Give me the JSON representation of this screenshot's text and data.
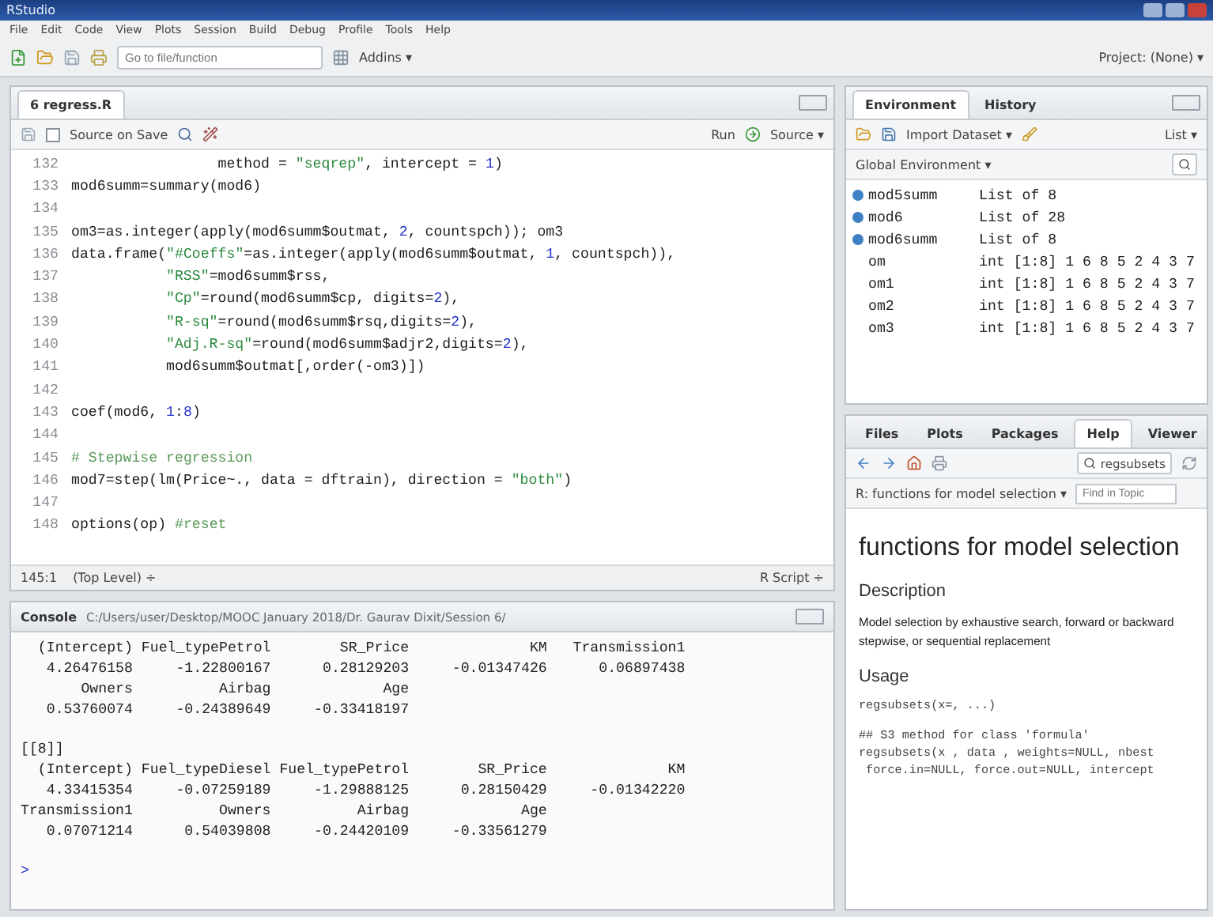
{
  "window": {
    "title": "RStudio"
  },
  "menu": [
    "File",
    "Edit",
    "Code",
    "View",
    "Plots",
    "Session",
    "Build",
    "Debug",
    "Profile",
    "Tools",
    "Help"
  ],
  "toolbar": {
    "goto_placeholder": "Go to file/function",
    "addins": "Addins ▾",
    "project": "Project: (None) ▾"
  },
  "editor": {
    "tabs": [
      {
        "label": "6 regress.R",
        "selected": true
      }
    ],
    "toolbar": {
      "source_on_save": "Source on Save",
      "source_on_save_checked": false,
      "run": "Run",
      "source": "Source ▾"
    },
    "lines": [
      {
        "number": "132",
        "segments": [
          {
            "kind": "plain",
            "text": "                 method = "
          },
          {
            "kind": "string",
            "text": "\"seqrep\""
          },
          {
            "kind": "plain",
            "text": ", intercept = "
          },
          {
            "kind": "number",
            "text": "1"
          },
          {
            "kind": "plain",
            "text": ")"
          }
        ]
      },
      {
        "number": "133",
        "segments": [
          {
            "kind": "plain",
            "text": "mod6summ=summary(mod6)"
          }
        ]
      },
      {
        "number": "134"
      },
      {
        "number": "135",
        "segments": [
          {
            "kind": "plain",
            "text": "om3=as.integer(apply(mod6summ$outmat, "
          },
          {
            "kind": "number",
            "text": "2"
          },
          {
            "kind": "plain",
            "text": ", countspch)); om3"
          }
        ]
      },
      {
        "number": "136",
        "segments": [
          {
            "kind": "plain",
            "text": "data.frame("
          },
          {
            "kind": "string",
            "text": "\"#Coeffs\""
          },
          {
            "kind": "plain",
            "text": "=as.integer(apply(mod6summ$outmat, "
          },
          {
            "kind": "number",
            "text": "1"
          },
          {
            "kind": "plain",
            "text": ", countspch)),"
          }
        ]
      },
      {
        "number": "137",
        "indented": true,
        "segments": [
          {
            "kind": "string",
            "text": "\"RSS\""
          },
          {
            "kind": "plain",
            "text": "=mod6summ$rss,"
          }
        ]
      },
      {
        "number": "138",
        "indented": true,
        "segments": [
          {
            "kind": "string",
            "text": "\"Cp\""
          },
          {
            "kind": "plain",
            "text": "=round(mod6summ$cp, digits="
          },
          {
            "kind": "number",
            "text": "2"
          },
          {
            "kind": "plain",
            "text": "),"
          }
        ]
      },
      {
        "number": "139",
        "indented": true,
        "segments": [
          {
            "kind": "string",
            "text": "\"R-sq\""
          },
          {
            "kind": "plain",
            "text": "=round(mod6summ$rsq,digits="
          },
          {
            "kind": "number",
            "text": "2"
          },
          {
            "kind": "plain",
            "text": "),"
          }
        ]
      },
      {
        "number": "140",
        "indented": true,
        "segments": [
          {
            "kind": "string",
            "text": "\"Adj.R-sq\""
          },
          {
            "kind": "plain",
            "text": "=round(mod6summ$adjr2,digits="
          },
          {
            "kind": "number",
            "text": "2"
          },
          {
            "kind": "plain",
            "text": "),"
          }
        ]
      },
      {
        "number": "141",
        "indented": true,
        "segments": [
          {
            "kind": "plain",
            "text": "mod6summ$outmat[,order(-om3)])"
          }
        ]
      },
      {
        "number": "142"
      },
      {
        "number": "143",
        "segments": [
          {
            "kind": "plain",
            "text": "coef(mod6, "
          },
          {
            "kind": "number",
            "text": "1"
          },
          {
            "kind": "plain",
            "text": ":"
          },
          {
            "kind": "number",
            "text": "8"
          },
          {
            "kind": "plain",
            "text": ")"
          }
        ]
      },
      {
        "number": "144"
      },
      {
        "number": "145",
        "segments": [
          {
            "kind": "comment",
            "text": "# Stepwise regression"
          }
        ]
      },
      {
        "number": "146",
        "segments": [
          {
            "kind": "plain",
            "text": "mod7=step(lm(Price~., data = dftrain), direction = "
          },
          {
            "kind": "string",
            "text": "\"both\""
          },
          {
            "kind": "plain",
            "text": ")"
          }
        ]
      },
      {
        "number": "147"
      },
      {
        "number": "148",
        "segments": [
          {
            "kind": "plain",
            "text": "options(op) "
          },
          {
            "kind": "comment",
            "text": "#reset"
          }
        ]
      }
    ],
    "status": {
      "position": "145:1",
      "scope": "(Top Level) ÷",
      "type": "R Script ÷"
    }
  },
  "console": {
    "title": "Console",
    "path": "C:/Users/user/Desktop/MOOC January 2018/Dr. Gaurav Dixit/Session 6/",
    "blocks": [
      [
        "  (Intercept) Fuel_typePetrol        SR_Price              KM   Transmission1",
        "   4.26476158     -1.22800167      0.28129203     -0.01347426      0.06897438",
        "       Owners          Airbag             Age",
        "   0.53760074     -0.24389649     -0.33418197"
      ],
      [
        "[[8]]",
        "  (Intercept) Fuel_typeDiesel Fuel_typePetrol        SR_Price              KM",
        "   4.33415354     -0.07259189     -1.29888125      0.28150429     -0.01342220",
        "Transmission1          Owners          Airbag             Age",
        "   0.07071214      0.54039808     -0.24420109     -0.33561279"
      ]
    ],
    "prompt": ">"
  },
  "environment": {
    "tabs": [
      {
        "label": "Environment",
        "selected": true
      },
      {
        "label": "History",
        "selected": false
      }
    ],
    "import": "Import Dataset ▾",
    "view": "List ▾",
    "scope": "Global Environment ▾",
    "rows": [
      {
        "kind": "data",
        "name": "mod5summ",
        "value": "List of 8"
      },
      {
        "kind": "data",
        "name": "mod6",
        "value": "List of 28"
      },
      {
        "kind": "data",
        "name": "mod6summ",
        "value": "List of 8"
      },
      {
        "kind": "value",
        "name": "om",
        "value": "int [1:8] 1 6 8 5 2 4 3 7"
      },
      {
        "kind": "value",
        "name": "om1",
        "value": "int [1:8] 1 6 8 5 2 4 3 7"
      },
      {
        "kind": "value",
        "name": "om2",
        "value": "int [1:8] 1 6 8 5 2 4 3 7"
      },
      {
        "kind": "value",
        "name": "om3",
        "value": "int [1:8] 1 6 8 5 2 4 3 7"
      }
    ]
  },
  "help": {
    "tabs": [
      {
        "label": "Files",
        "selected": false
      },
      {
        "label": "Plots",
        "selected": false
      },
      {
        "label": "Packages",
        "selected": false
      },
      {
        "label": "Help",
        "selected": true
      },
      {
        "label": "Viewer",
        "selected": false
      }
    ],
    "search": "regsubsets",
    "topic": "R: functions for model selection ▾",
    "find_placeholder": "Find in Topic",
    "title": "functions for model selection",
    "sections": [
      {
        "kind": "heading",
        "text": "Description"
      },
      {
        "kind": "paragraph",
        "text": "Model selection by exhaustive search, forward or backward stepwise, or sequential replacement"
      },
      {
        "kind": "heading",
        "text": "Usage"
      },
      {
        "kind": "code",
        "text": "regsubsets(x=, ...)"
      },
      {
        "kind": "code",
        "text": "## S3 method for class 'formula'\nregsubsets(x , data , weights=NULL, nbest\n force.in=NULL, force.out=NULL, intercept"
      }
    ]
  }
}
